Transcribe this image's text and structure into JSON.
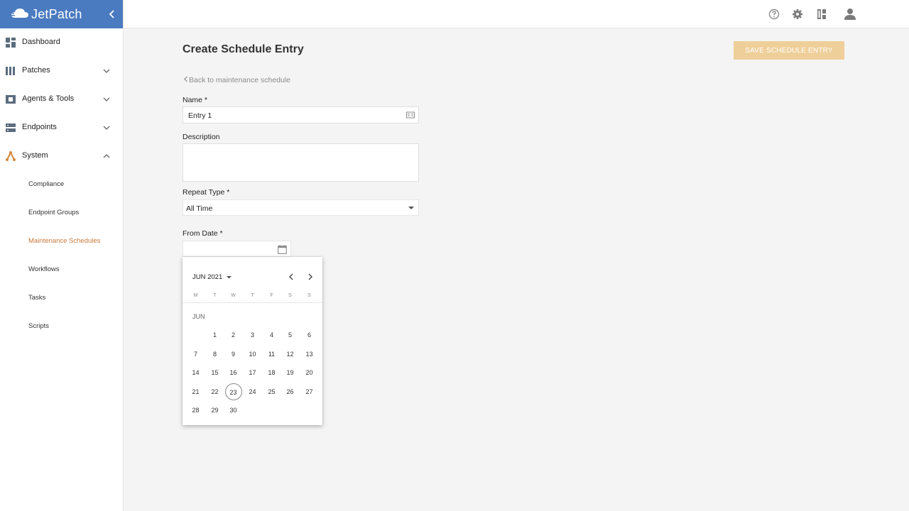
{
  "brand": {
    "name": "JetPatch",
    "color": "#4a7ac0"
  },
  "sidebar": {
    "items": [
      {
        "label": "Dashboard",
        "icon": "dashboard-icon"
      },
      {
        "label": "Patches",
        "icon": "patches-icon",
        "expandable": true
      },
      {
        "label": "Agents & Tools",
        "icon": "agents-icon",
        "expandable": true
      },
      {
        "label": "Endpoints",
        "icon": "endpoints-icon",
        "expandable": true
      },
      {
        "label": "System",
        "icon": "system-icon",
        "expandable": true,
        "expanded": true
      }
    ],
    "subitems": [
      {
        "label": "Compliance"
      },
      {
        "label": "Endpoint Groups"
      },
      {
        "label": "Maintenance Schedules",
        "active": true
      },
      {
        "label": "Workflows"
      },
      {
        "label": "Tasks"
      },
      {
        "label": "Scripts"
      }
    ]
  },
  "topbar": {
    "icons": [
      "help-icon",
      "settings-icon",
      "apps-icon",
      "user-icon"
    ]
  },
  "page": {
    "title": "Create Schedule Entry",
    "save_label": "SAVE SCHEDULE ENTRY",
    "back_label": "Back to maintenance schedule"
  },
  "form": {
    "name_label": "Name *",
    "name_value": "Entry 1",
    "description_label": "Description",
    "description_value": "",
    "repeat_label": "Repeat Type *",
    "repeat_value": "All Time",
    "from_label": "From Date *",
    "from_value": ""
  },
  "calendar": {
    "header": "JUN 2021",
    "month_label": "JUN",
    "weekdays": [
      "M",
      "T",
      "W",
      "T",
      "F",
      "S",
      "S"
    ],
    "first_weekday_index": 1,
    "days": 30,
    "today": 23
  },
  "colors": {
    "accent": "#c9783a",
    "save_disabled": "#efcf99"
  }
}
